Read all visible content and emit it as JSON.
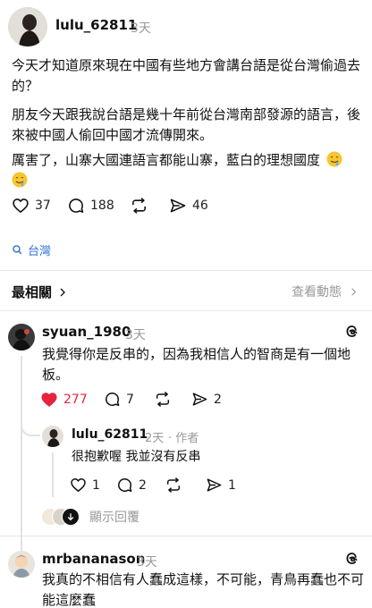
{
  "post": {
    "username": "lulu_62811",
    "time": "3天",
    "paragraphs": [
      "今天才知道原來現在中國有些地方會講台語是從台灣偷過去的？",
      "朋友今天跟我說台語是幾十年前從台灣南部發源的語言，後來被中國人偷回中國才流傳開來。",
      "厲害了，山寨大國連語言都能山寨，藍白的理想國度"
    ],
    "emoji_names": [
      "drooling-face-emoji",
      "drooling-face-emoji"
    ],
    "likes": "37",
    "comments": "188",
    "shares": "46",
    "topic": "台灣"
  },
  "sort": {
    "label": "最相關",
    "view_activity": "查看動態"
  },
  "replies": [
    {
      "username": "syuan_1980",
      "time": "3天",
      "text": "我覺得你是反串的，因為我相信人的智商是有一個地板。",
      "likes": "277",
      "comments": "7",
      "shares": "2",
      "liked": true
    },
    {
      "username": "lulu_62811",
      "time": "2天",
      "author_tag": "· 作者",
      "text": "很抱歉喔 我並沒有反串",
      "likes": "1",
      "comments": "2",
      "shares": "1"
    },
    {
      "show_replies": "顯示回覆"
    },
    {
      "username": "mrbananason",
      "time": "3天",
      "text": "我真的不相信有人蠢成這樣，不可能，青鳥再蠢也不可能這麼蠢"
    }
  ],
  "colors": {
    "heart_red": "#e5253f",
    "topic_blue": "#2a6fd6",
    "muted": "#999999"
  }
}
